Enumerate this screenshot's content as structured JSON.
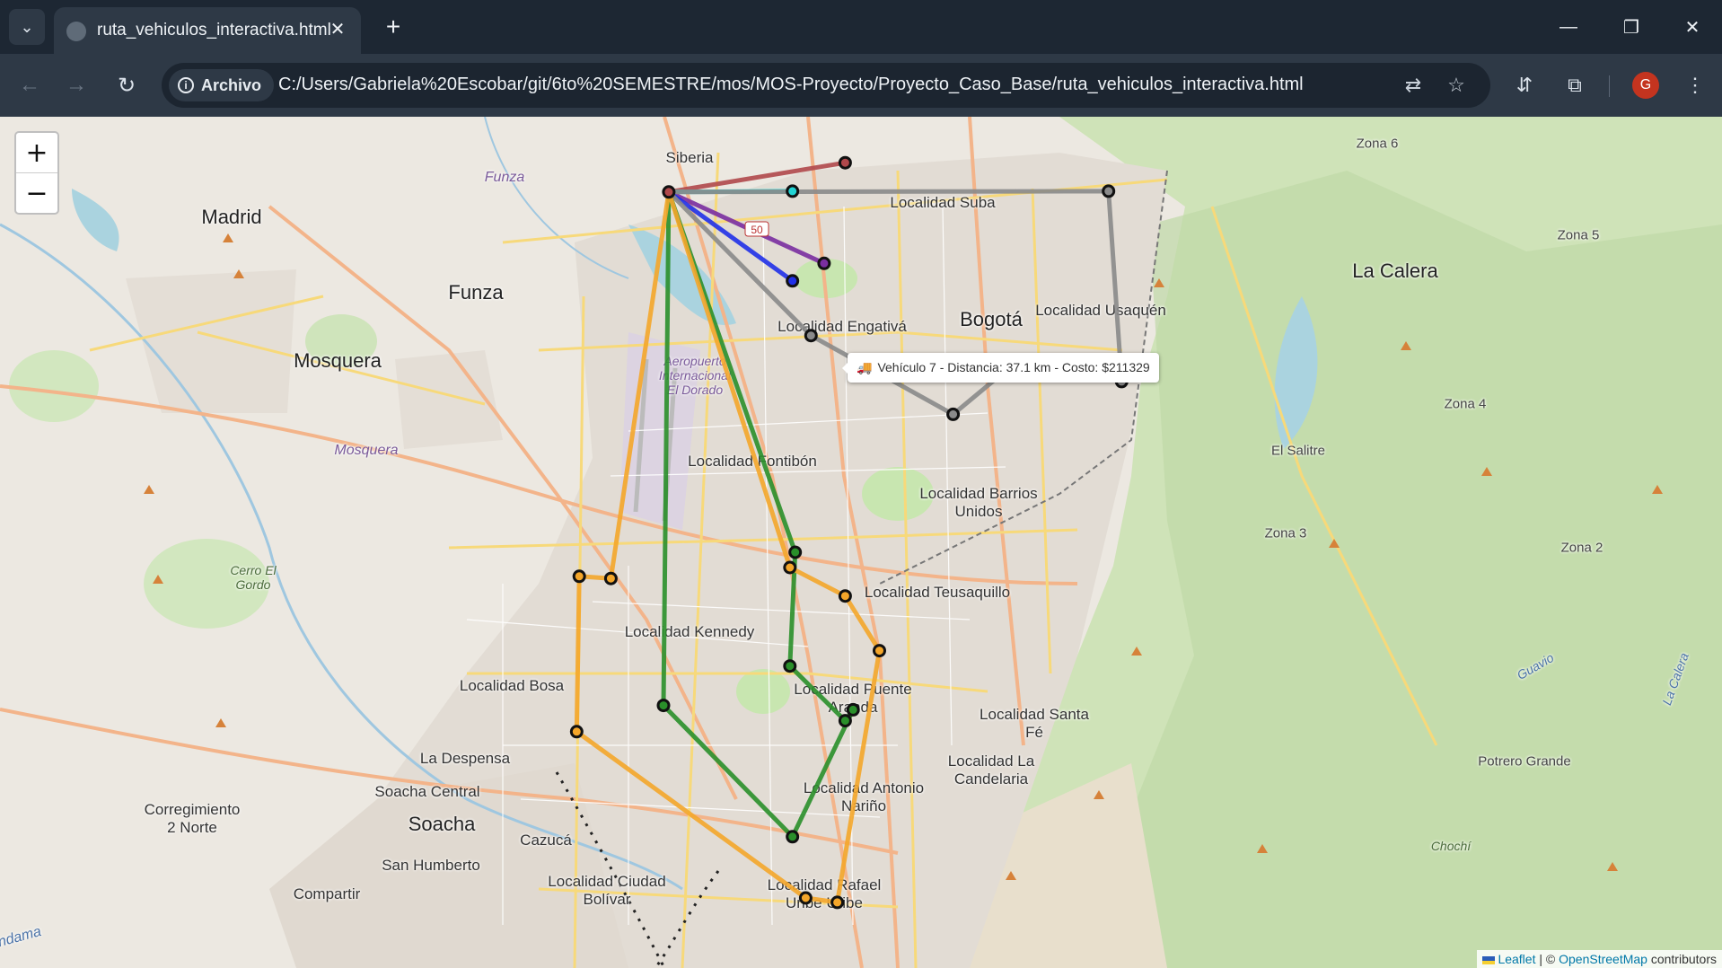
{
  "browser": {
    "tab_title": "ruta_vehiculos_interactiva.html",
    "security_chip": "Archivo",
    "url": "C:/Users/Gabriela%20Escobar/git/6to%20SEMESTRE/mos/MOS-Proyecto/Proyecto_Caso_Base/ruta_vehiculos_interactiva.html",
    "profile_initial": "G"
  },
  "map": {
    "zoom_in": "+",
    "zoom_out": "−",
    "tooltip": "Vehículo 7 - Distancia: 37.1 km - Costo: $211329",
    "attribution": {
      "leaflet": "Leaflet",
      "separator": " | © ",
      "osm": "OpenStreetMap",
      "suffix": " contributors"
    },
    "road_shield": "50",
    "places": {
      "siberia": "Siberia",
      "funza_top": "Funza",
      "madrid": "Madrid",
      "funza": "Funza",
      "mosquera": "Mosquera",
      "mosquera_it": "Mosquera",
      "suba": "Localidad Suba",
      "engativa": "Localidad Engativá",
      "bogota": "Bogotá",
      "usaquen": "Localidad Usaquén",
      "zona6": "Zona 6",
      "zona5": "Zona 5",
      "la_calera": "La Calera",
      "zona4": "Zona 4",
      "el_salitre": "El Salitre",
      "zona3": "Zona 3",
      "zona2": "Zona 2",
      "aeropuerto": "Aeropuerto Internacional El Dorado",
      "fontibon": "Localidad Fontibón",
      "barrios_unidos": "Localidad Barrios Unidos",
      "cerro_el_gordo": "Cerro El Gordo",
      "teusaquillo": "Localidad Teusaquillo",
      "kennedy": "Localidad Kennedy",
      "bosa": "Localidad Bosa",
      "puente_aranda": "Localidad Puente Aranda",
      "santa_fe": "Localidad Santa Fé",
      "la_candelaria": "Localidad La Candelaria",
      "la_despensa": "La Despensa",
      "soacha_central": "Soacha Central",
      "soacha": "Soacha",
      "cazuca": "Cazucá",
      "corregimiento": "Corregimiento 2 Norte",
      "antonio_narino": "Localidad Antonio Nariño",
      "san_humberto": "San Humberto",
      "ciudad_bolivar": "Localidad Ciudad Bolívar",
      "compartir": "Compartir",
      "rafael_uribe": "Localidad Rafael Uribe Uribe",
      "potrero_grande": "Potrero Grande",
      "guavio": "Guavio",
      "la_calera_it": "La Calera",
      "chochi": "Chochí",
      "andama": "ndama"
    },
    "routes": [
      {
        "name": "route-dark-red",
        "color": "#b0484b",
        "stops": [
          [
            4.7946,
            -74.162
          ],
          [
            4.808,
            -74.095
          ]
        ]
      },
      {
        "name": "route-cyan",
        "color": "#22d4d4",
        "stops": [
          [
            4.7946,
            -74.162
          ],
          [
            4.795,
            -74.115
          ]
        ]
      },
      {
        "name": "route-purple",
        "color": "#7a2ea0",
        "stops": [
          [
            4.7946,
            -74.162
          ],
          [
            4.762,
            -74.103
          ]
        ]
      },
      {
        "name": "route-blue",
        "color": "#2030e8",
        "stops": [
          [
            4.7946,
            -74.162
          ],
          [
            4.754,
            -74.115
          ]
        ]
      },
      {
        "name": "route-gray",
        "color": "#8a8a8a",
        "stops": [
          [
            4.7946,
            -74.162
          ],
          [
            4.729,
            -74.108
          ],
          [
            4.693,
            -74.054
          ],
          [
            4.717,
            -74.03
          ],
          [
            4.708,
            -73.99
          ],
          [
            4.795,
            -73.995
          ],
          [
            4.7946,
            -74.162
          ]
        ]
      },
      {
        "name": "route-green",
        "color": "#2a8f2a",
        "stops": [
          [
            4.7946,
            -74.162
          ],
          [
            4.63,
            -74.114
          ],
          [
            4.578,
            -74.116
          ],
          [
            4.553,
            -74.095
          ],
          [
            4.558,
            -74.092
          ],
          [
            4.5,
            -74.115
          ],
          [
            4.56,
            -74.164
          ],
          [
            4.7946,
            -74.162
          ]
        ]
      },
      {
        "name": "route-orange",
        "color": "#f4a62a",
        "stops": [
          [
            4.7946,
            -74.162
          ],
          [
            4.623,
            -74.116
          ],
          [
            4.61,
            -74.095
          ],
          [
            4.585,
            -74.082
          ],
          [
            4.47,
            -74.098
          ],
          [
            4.472,
            -74.11
          ],
          [
            4.548,
            -74.197
          ],
          [
            4.619,
            -74.196
          ],
          [
            4.618,
            -74.184
          ],
          [
            4.7946,
            -74.162
          ]
        ]
      }
    ]
  }
}
